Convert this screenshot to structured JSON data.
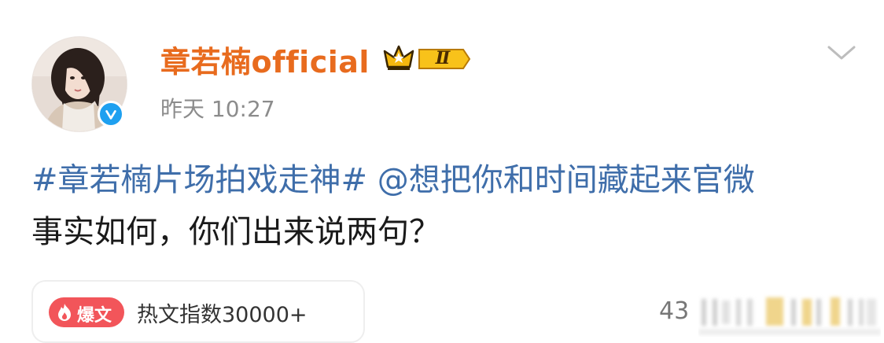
{
  "post": {
    "author": {
      "name": "章若楠official",
      "vip_level": "Ⅱ",
      "verified": true
    },
    "timestamp": "昨天 10:27",
    "content": {
      "hashtag": "#章若楠片场拍戏走神#",
      "mention": "@想把你和时间藏起来官微",
      "text": "事实如何，你们出来说两句？"
    },
    "hot_badge": {
      "label": "爆文",
      "text": "热文指数30000+"
    },
    "count": "43"
  },
  "icons": {
    "menu": "chevron-down-icon",
    "verified": "verified-check-icon",
    "vip": "crown-vip-icon",
    "hot": "flame-icon"
  },
  "colors": {
    "username": "#e86b1e",
    "link": "#3f6eaa",
    "timestamp": "#8c8c8c",
    "hot_pill": "#f2555a",
    "verified_badge": "#1ea0f0"
  }
}
